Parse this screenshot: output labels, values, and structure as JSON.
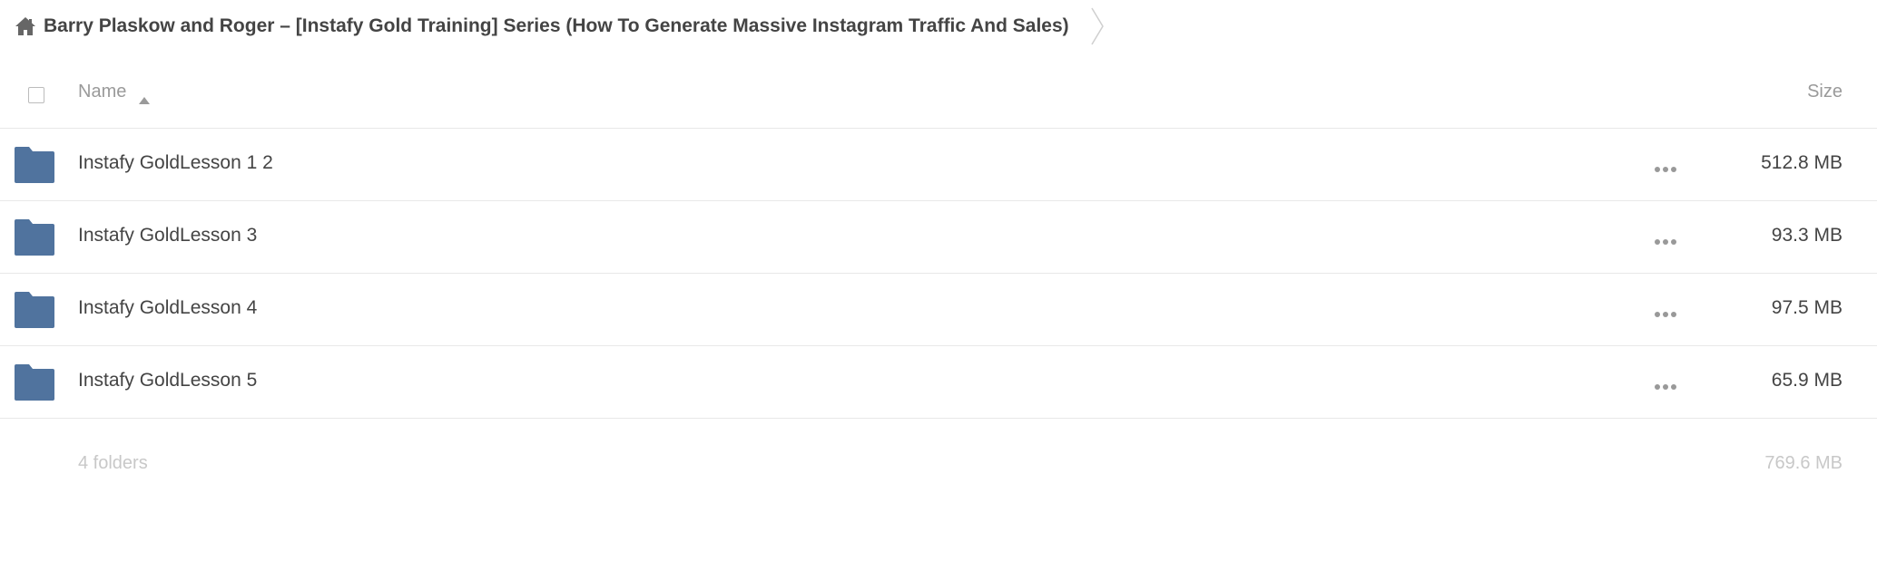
{
  "breadcrumb": {
    "title": "Barry Plaskow and Roger – [Instafy Gold Training] Series (How To Generate Massive Instagram Traffic And Sales)"
  },
  "header": {
    "name_label": "Name",
    "size_label": "Size"
  },
  "rows": [
    {
      "name": "Instafy GoldLesson 1 2",
      "size": "512.8 MB"
    },
    {
      "name": "Instafy GoldLesson 3",
      "size": "93.3 MB"
    },
    {
      "name": "Instafy GoldLesson 4",
      "size": "97.5 MB"
    },
    {
      "name": "Instafy GoldLesson 5",
      "size": "65.9 MB"
    }
  ],
  "footer": {
    "count": "4 folders",
    "total_size": "769.6 MB"
  },
  "colors": {
    "folder": "#50739e",
    "text": "#444444",
    "muted": "#9a9a9a",
    "footer": "#c8c8c8",
    "divider": "#e8e8e8"
  }
}
